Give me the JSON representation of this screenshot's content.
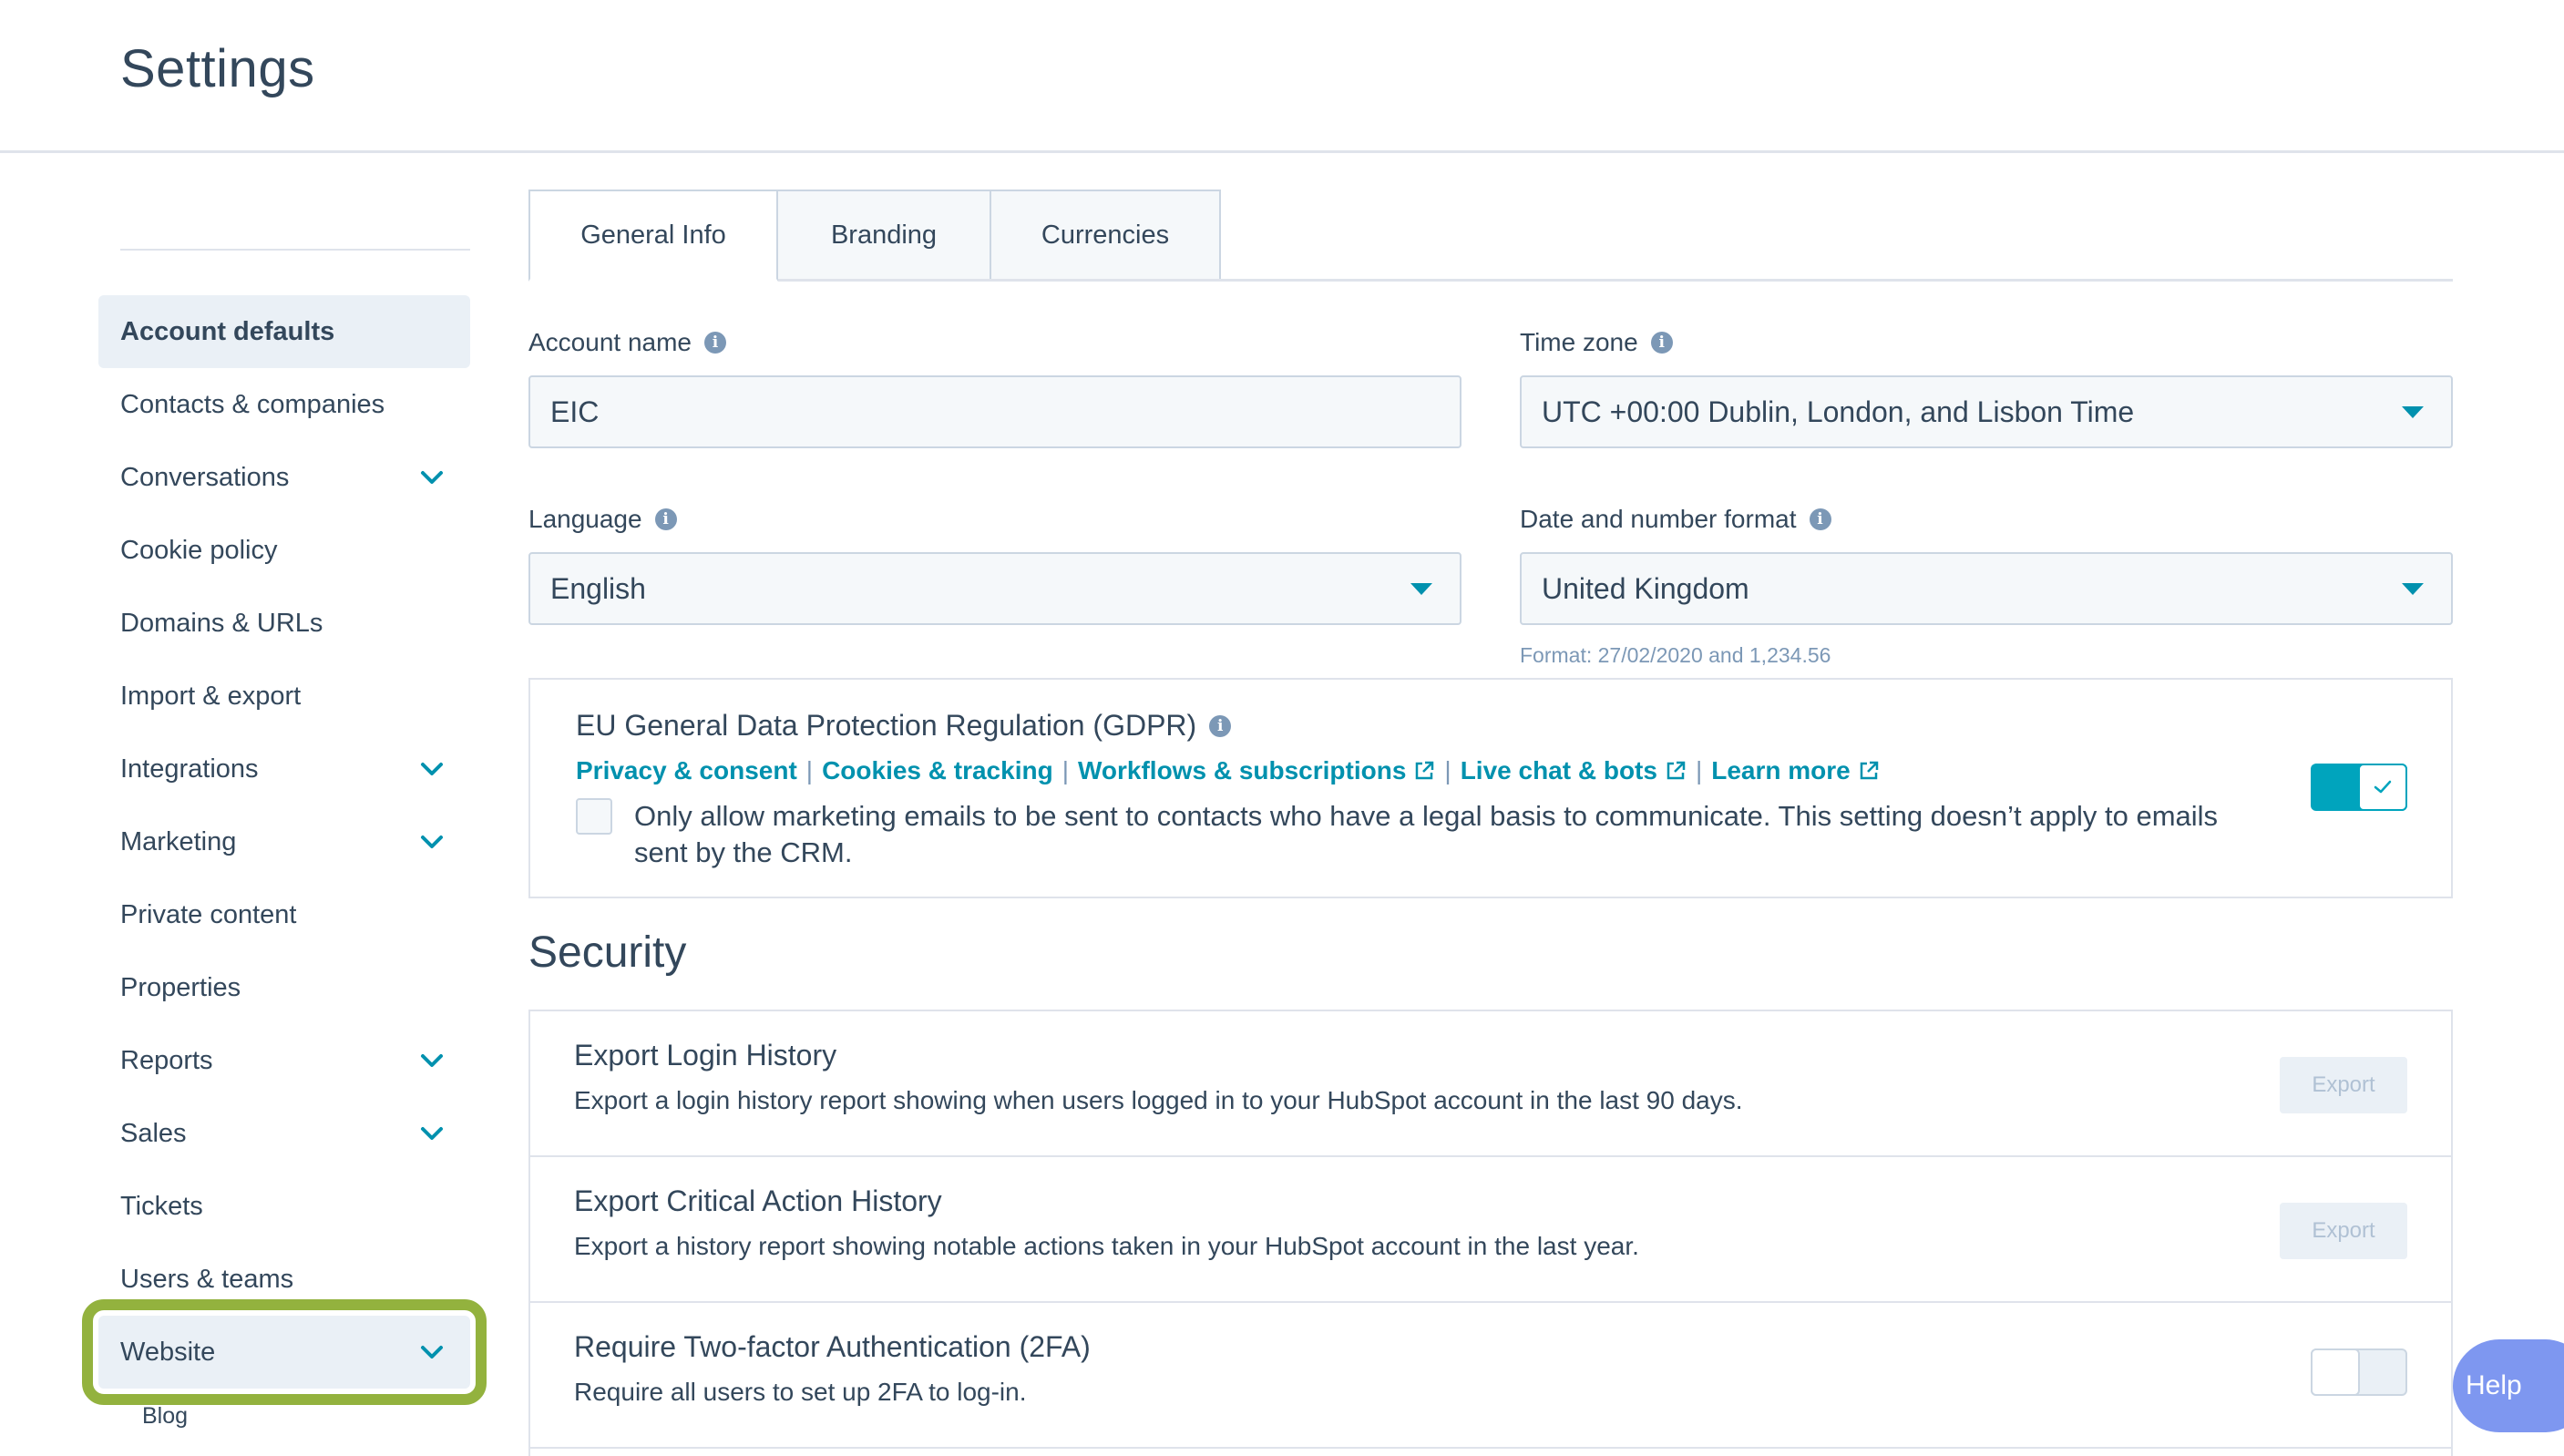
{
  "page": {
    "title": "Settings"
  },
  "sidebar": {
    "items": [
      {
        "label": "Account defaults",
        "active": true,
        "expandable": false
      },
      {
        "label": "Contacts & companies",
        "expandable": false
      },
      {
        "label": "Conversations",
        "expandable": true
      },
      {
        "label": "Cookie policy",
        "expandable": false
      },
      {
        "label": "Domains & URLs",
        "expandable": false
      },
      {
        "label": "Import & export",
        "expandable": false
      },
      {
        "label": "Integrations",
        "expandable": true
      },
      {
        "label": "Marketing",
        "expandable": true
      },
      {
        "label": "Private content",
        "expandable": false
      },
      {
        "label": "Properties",
        "expandable": false
      },
      {
        "label": "Reports",
        "expandable": true
      },
      {
        "label": "Sales",
        "expandable": true
      },
      {
        "label": "Tickets",
        "expandable": false
      },
      {
        "label": "Users & teams",
        "expandable": false
      },
      {
        "label": "Website",
        "expandable": true,
        "highlighted": true
      }
    ],
    "subitems": [
      {
        "label": "Blog"
      }
    ]
  },
  "tabs": [
    {
      "label": "General Info",
      "active": true
    },
    {
      "label": "Branding"
    },
    {
      "label": "Currencies"
    }
  ],
  "form": {
    "account_name": {
      "label": "Account name",
      "value": "EIC"
    },
    "time_zone": {
      "label": "Time zone",
      "value": "UTC +00:00 Dublin, London, and Lisbon Time"
    },
    "language": {
      "label": "Language",
      "value": "English"
    },
    "date_format": {
      "label": "Date and number format",
      "value": "United Kingdom",
      "hint": "Format: 27/02/2020 and 1,234.56"
    }
  },
  "gdpr": {
    "title": "EU General Data Protection Regulation (GDPR)",
    "links": [
      "Privacy & consent",
      "Cookies & tracking",
      "Workflows & subscriptions",
      "Live chat & bots",
      "Learn more"
    ],
    "separator": "|",
    "checkbox_text": "Only allow marketing emails to be sent to contacts who have a legal basis to communicate. This setting doesn’t apply to emails sent by the CRM.",
    "checkbox_checked": false,
    "enabled": true
  },
  "security": {
    "title": "Security",
    "rows": [
      {
        "title": "Export Login History",
        "desc": "Export a login history report showing when users logged in to your HubSpot account in the last 90 days.",
        "button": "Export"
      },
      {
        "title": "Export Critical Action History",
        "desc": "Export a history report showing notable actions taken in your HubSpot account in the last year.",
        "button": "Export"
      },
      {
        "title": "Require Two-factor Authentication (2FA)",
        "desc": "Require all users to set up 2FA to log-in.",
        "toggle_enabled": false
      }
    ]
  },
  "help": {
    "label": "Help"
  },
  "colors": {
    "accent": "#0091ae",
    "toggle_on": "#00a4bd",
    "highlight_outline": "#93b23e",
    "help_button": "#7e97f0"
  },
  "icons": {
    "info": "info-icon",
    "chevron": "chevron-down-icon",
    "caret": "caret-down-icon",
    "external": "external-link-icon",
    "check": "check-icon"
  }
}
